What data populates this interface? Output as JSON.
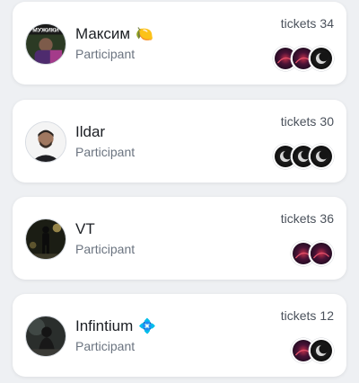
{
  "participants": [
    {
      "name": "Максим",
      "emoji": "🍋",
      "role": "Participant",
      "tickets_label": "tickets",
      "tickets_count": "34",
      "avatar_caption": "МУЖИКИ",
      "nft_icons": [
        "nebula-nft-icon",
        "nebula-nft-icon",
        "moon-nft-icon"
      ]
    },
    {
      "name": "Ildar",
      "emoji": "",
      "role": "Participant",
      "tickets_label": "tickets",
      "tickets_count": "30",
      "nft_icons": [
        "moon-nft-icon",
        "moon-nft-icon",
        "moon-nft-icon"
      ]
    },
    {
      "name": "VT",
      "emoji": "",
      "role": "Participant",
      "tickets_label": "tickets",
      "tickets_count": "36",
      "nft_icons": [
        "nebula-nft-icon",
        "nebula-nft-icon"
      ]
    },
    {
      "name": "Infintium",
      "emoji": "💠",
      "role": "Participant",
      "tickets_label": "tickets",
      "tickets_count": "12",
      "nft_icons": [
        "nebula-nft-icon",
        "moon-nft-icon"
      ]
    }
  ],
  "colors": {
    "page_bg": "#eef0f3",
    "card_bg": "#ffffff",
    "name_text": "#1c1f24",
    "secondary_text": "#6b7480",
    "nebula_nft": "#3a1030",
    "moon_nft": "#111111"
  }
}
